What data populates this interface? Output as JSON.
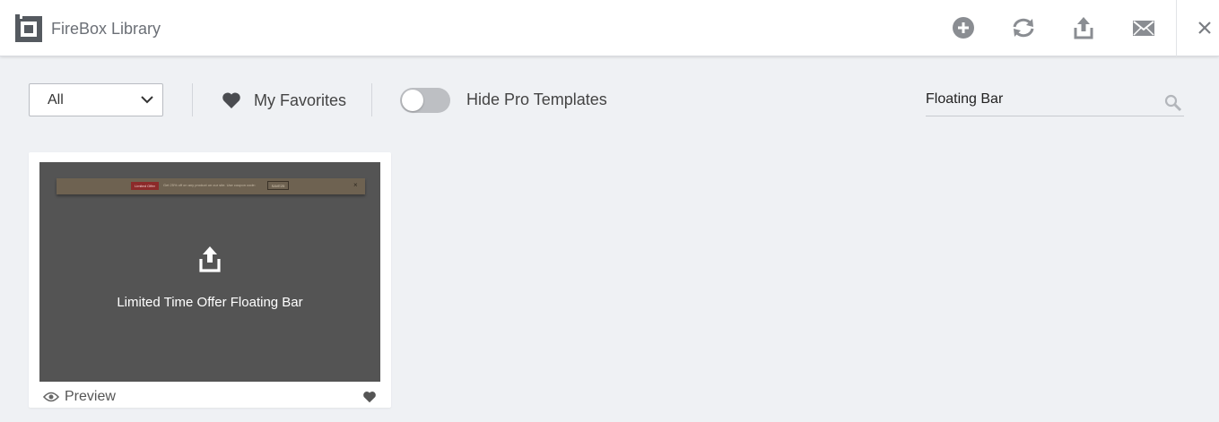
{
  "header": {
    "title": "FireBox Library",
    "icons": [
      "plus-circle-icon",
      "refresh-icon",
      "upload-icon",
      "mail-icon",
      "close-icon"
    ]
  },
  "toolbar": {
    "category_select": {
      "value": "All"
    },
    "favorites_label": "My Favorites",
    "toggle": {
      "label": "Hide Pro Templates",
      "checked": false
    },
    "search": {
      "value": "Floating Bar",
      "placeholder": ""
    }
  },
  "templates": [
    {
      "title": "Limited Time Offer Floating Bar",
      "preview_label": "Preview",
      "thumbnail": {
        "badge": "Limited Offer",
        "message": "Get 25% off on any product on our site. Use coupon code:",
        "code": "SAVE25",
        "close": "×"
      }
    }
  ],
  "colors": {
    "background": "#eff1f4",
    "thumbnail_overlay": "#545454",
    "icon_gray": "#8a8d92",
    "toggle_off": "#bdbfc3"
  }
}
